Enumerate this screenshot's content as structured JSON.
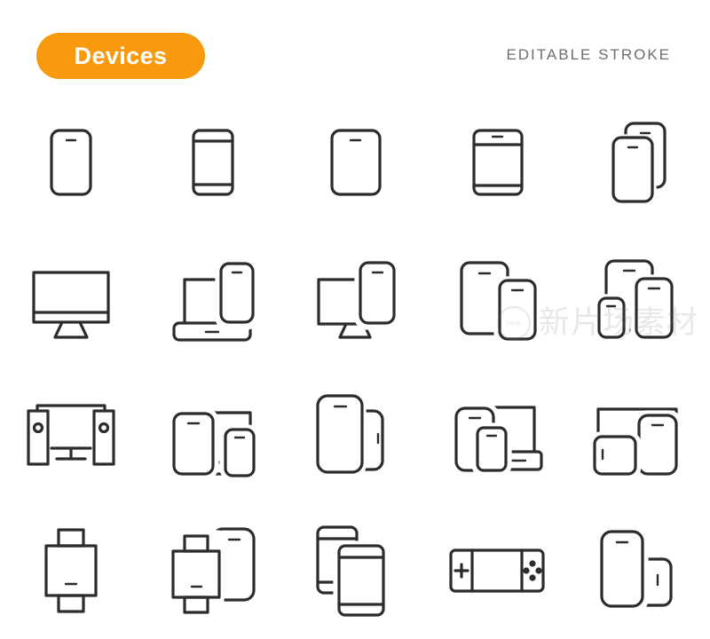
{
  "header": {
    "badge_label": "Devices",
    "badge_color": "#F89A0E",
    "badge_text_color": "#FFFFFF",
    "note_label": "EDITABLE STROKE",
    "note_color": "#6E6E6E"
  },
  "style": {
    "stroke_color": "#2C2C2C",
    "background_color": "#FFFFFF"
  },
  "watermark": {
    "text": "新片场素材",
    "logo_label": "new"
  },
  "grid": {
    "columns": 5,
    "rows": 4,
    "total_icons": 20
  },
  "icons": [
    {
      "index": 1,
      "row": 1,
      "col": 1,
      "name": "smartphone",
      "label": "Smartphone"
    },
    {
      "index": 2,
      "row": 1,
      "col": 2,
      "name": "smartphone-bezel",
      "label": "Smartphone with Bezels"
    },
    {
      "index": 3,
      "row": 1,
      "col": 3,
      "name": "tablet",
      "label": "Tablet"
    },
    {
      "index": 4,
      "row": 1,
      "col": 4,
      "name": "tablet-bezel",
      "label": "Tablet with Bezels"
    },
    {
      "index": 5,
      "row": 1,
      "col": 5,
      "name": "two-smartphones",
      "label": "Two Smartphones"
    },
    {
      "index": 6,
      "row": 2,
      "col": 1,
      "name": "desktop-monitor",
      "label": "Desktop Monitor"
    },
    {
      "index": 7,
      "row": 2,
      "col": 2,
      "name": "laptop-and-smartphone",
      "label": "Laptop and Smartphone"
    },
    {
      "index": 8,
      "row": 2,
      "col": 3,
      "name": "monitor-and-smartphone",
      "label": "Monitor and Smartphone"
    },
    {
      "index": 9,
      "row": 2,
      "col": 4,
      "name": "tablet-and-smartphone",
      "label": "Tablet and Smartphone"
    },
    {
      "index": 10,
      "row": 2,
      "col": 5,
      "name": "tablet-and-two-smartphones",
      "label": "Tablet and Two Smartphones"
    },
    {
      "index": 11,
      "row": 3,
      "col": 1,
      "name": "television-with-speakers",
      "label": "Television with Speakers"
    },
    {
      "index": 12,
      "row": 3,
      "col": 2,
      "name": "monitor-tablet-smartphone",
      "label": "Monitor, Tablet and Smartphone"
    },
    {
      "index": 13,
      "row": 3,
      "col": 3,
      "name": "tablet-with-side-smartphone",
      "label": "Tablet with Smartphone"
    },
    {
      "index": 14,
      "row": 3,
      "col": 4,
      "name": "laptop-tablet-smartphone",
      "label": "Laptop, Tablet and Smartphone"
    },
    {
      "index": 15,
      "row": 3,
      "col": 5,
      "name": "monitor-tablet-horizontal-phone",
      "label": "Monitor, Tablet and Handheld"
    },
    {
      "index": 16,
      "row": 4,
      "col": 1,
      "name": "smartwatch",
      "label": "Smartwatch"
    },
    {
      "index": 17,
      "row": 4,
      "col": 2,
      "name": "smartwatch-and-smartphone",
      "label": "Smartwatch and Smartphone"
    },
    {
      "index": 18,
      "row": 4,
      "col": 3,
      "name": "two-stacked-smartphones",
      "label": "Two Stacked Smartphones"
    },
    {
      "index": 19,
      "row": 4,
      "col": 4,
      "name": "handheld-game-console",
      "label": "Handheld Game Console"
    },
    {
      "index": 20,
      "row": 4,
      "col": 5,
      "name": "smartphone-and-small-device",
      "label": "Smartphone and Small Device"
    }
  ]
}
